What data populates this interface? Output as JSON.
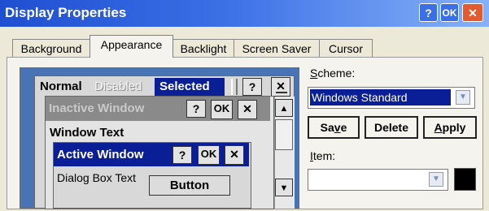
{
  "window": {
    "title": "Display Properties",
    "help_label": "?",
    "ok_label": "OK",
    "close_label": "✕"
  },
  "tabs": [
    {
      "label": "Background"
    },
    {
      "label": "Appearance"
    },
    {
      "label": "Backlight"
    },
    {
      "label": "Screen Saver"
    },
    {
      "label": "Cursor"
    }
  ],
  "preview": {
    "normal": "Normal",
    "disabled": "Disabled",
    "selected": "Selected",
    "menu_help": "?",
    "inactive_title": "Inactive Window",
    "window_text": "Window Text",
    "active_title": "Active Window",
    "dialog_text": "Dialog Box Text",
    "button_label": "Button",
    "help": "?",
    "ok": "OK",
    "close": "✕"
  },
  "scheme": {
    "label_prefix": "S",
    "label_rest": "cheme:",
    "value": "Windows Standard"
  },
  "buttons": {
    "save_a": "Sa",
    "save_u": "v",
    "save_b": "e",
    "delete": "Delete",
    "apply_u": "A",
    "apply_rest": "pply"
  },
  "item": {
    "label_prefix": "I",
    "label_rest": "tem:",
    "value": ""
  },
  "colors": {
    "title_bar": "#1f4fd1",
    "active_title": "#0a1e96",
    "inactive_title": "#8a8a8a",
    "selection": "#0a1e96",
    "desktop": "#4873b4",
    "close_button": "#e35a2e",
    "item_color_swatch": "#000000"
  }
}
